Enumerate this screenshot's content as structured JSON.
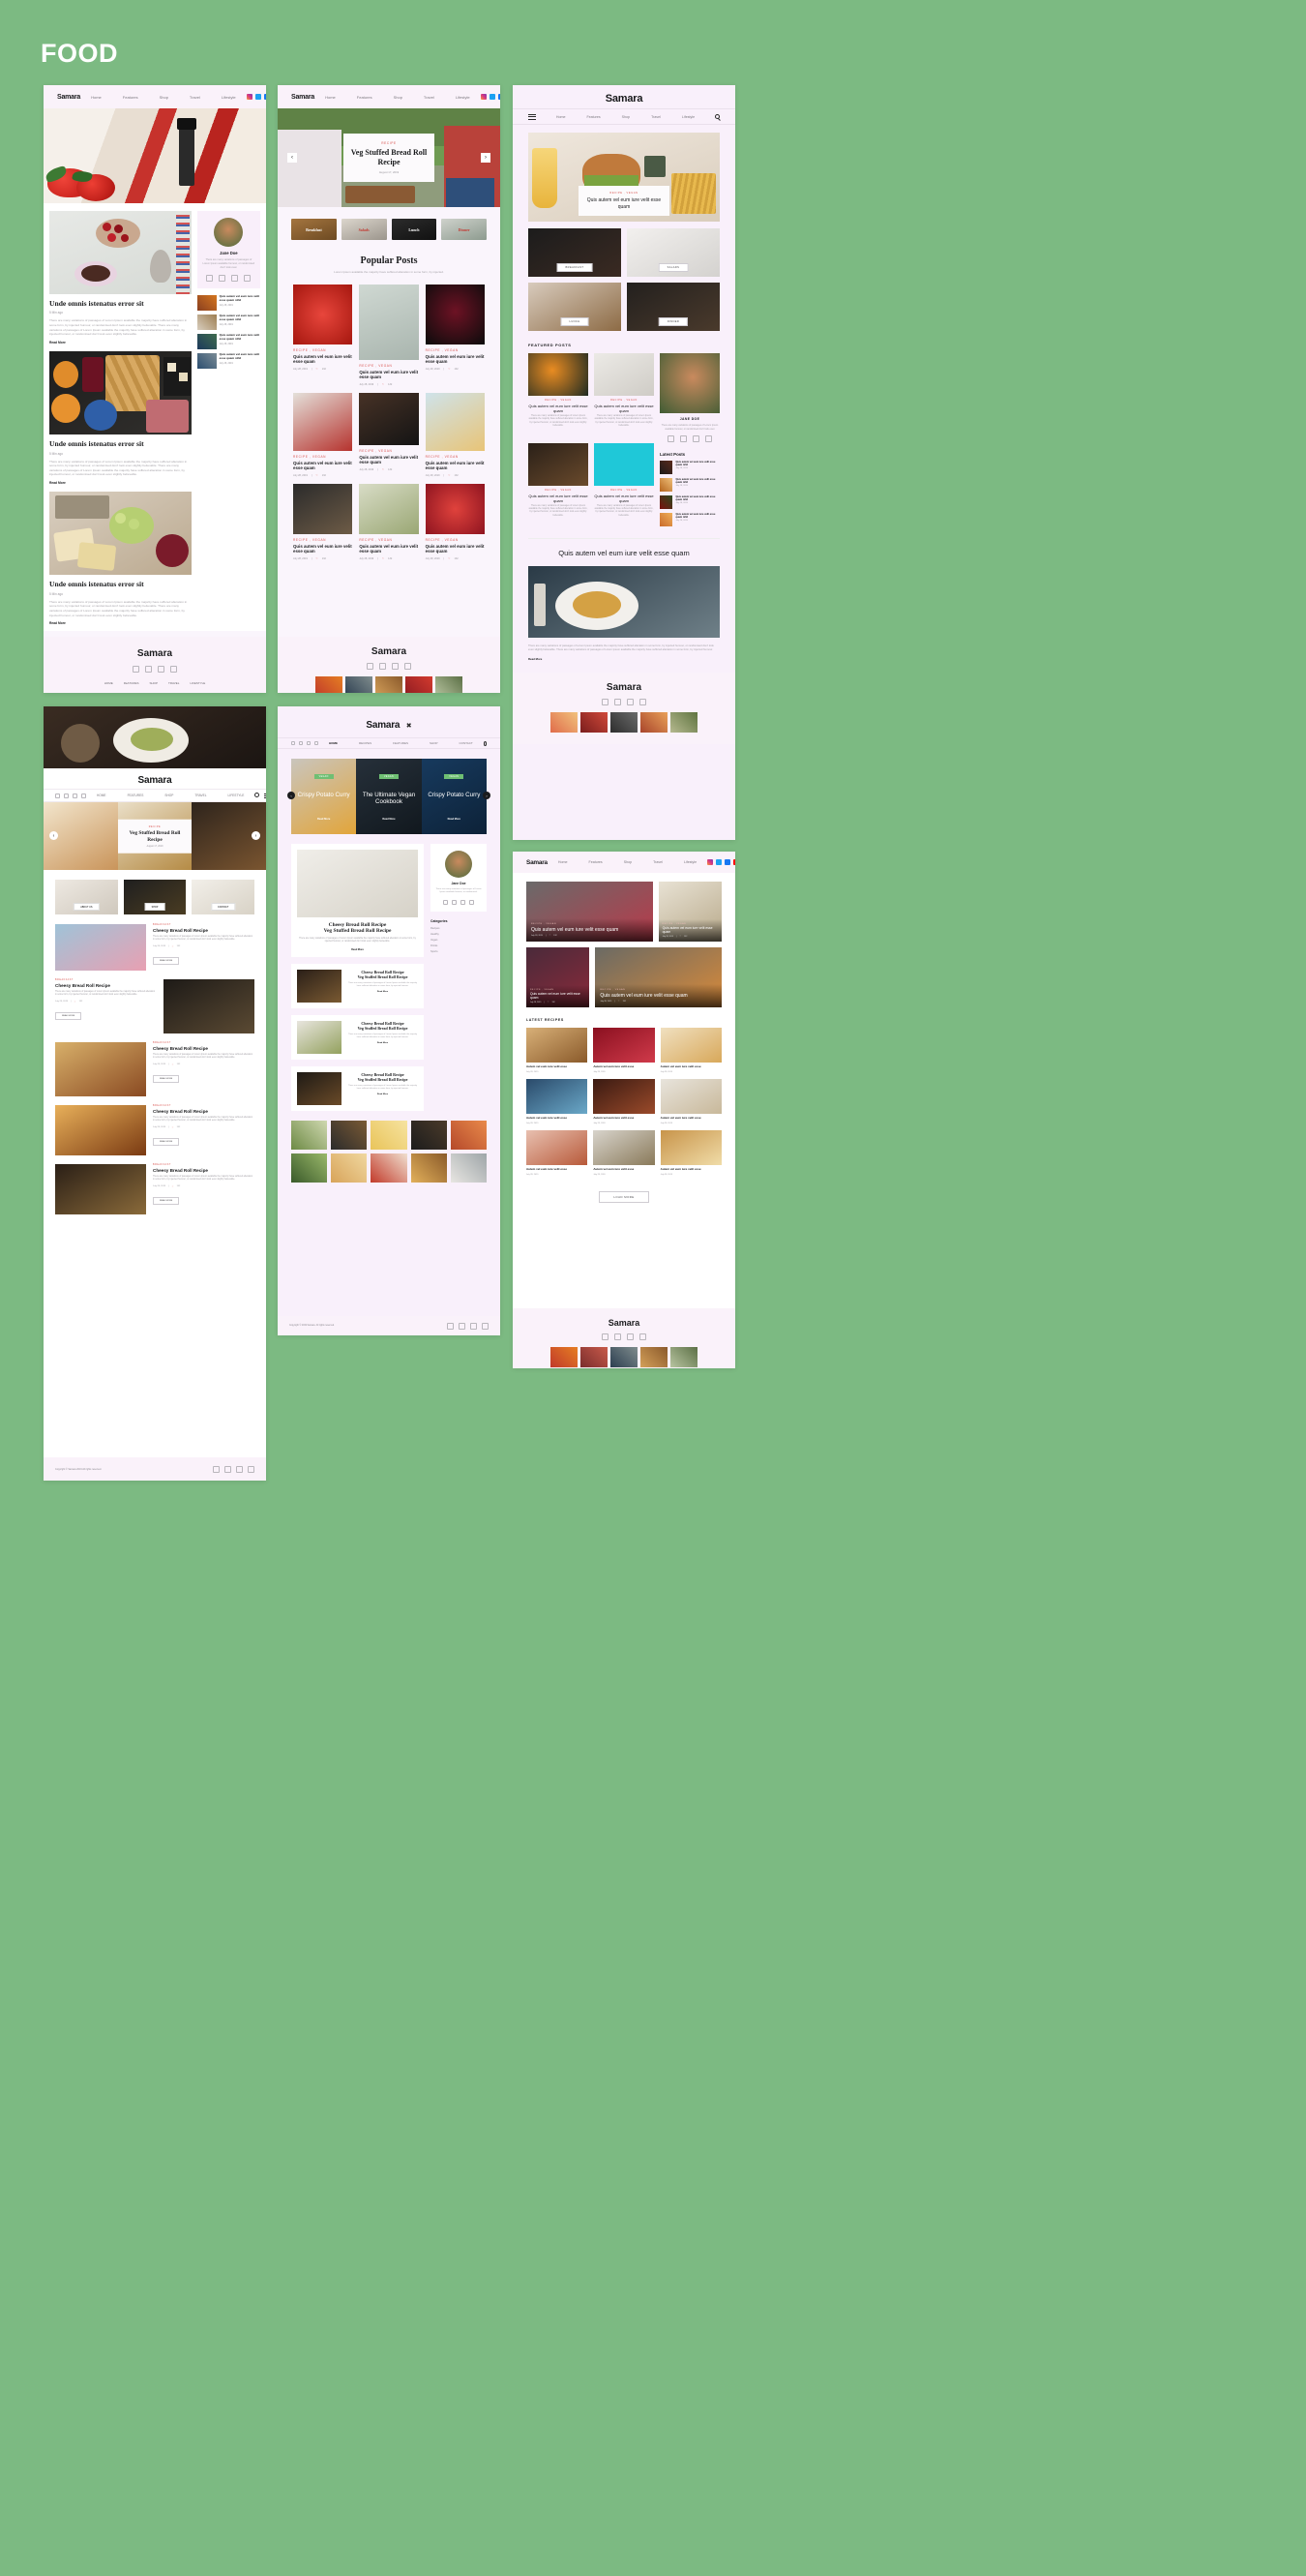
{
  "page": {
    "title": "FOOD",
    "background_color": "#7cba82",
    "card_bg": "#faf5fc"
  },
  "brand": {
    "name": "Samara",
    "name_x": "Samara"
  },
  "nav": {
    "primary": [
      "Home",
      "Features",
      "Shop",
      "Travel",
      "Lifestyle"
    ],
    "uppercase": [
      "HOME",
      "FEATURES",
      "SHOP",
      "TRAVEL",
      "LIFESTYLE"
    ],
    "samarax": [
      "HOME",
      "RECIPES",
      "FEATURES",
      "SHOP",
      "CONTACT"
    ],
    "socials": [
      "instagram-icon",
      "twitter-icon",
      "facebook-icon",
      "youtube-icon"
    ],
    "icons": {
      "menu": "hamburger-icon",
      "search": "search-icon"
    }
  },
  "mock1": {
    "posts": [
      {
        "title": "Unde omnis istenatus error sit",
        "date": "5 Min ago",
        "body": "There are many variations of passages of Lorem Ipsum available the majority have suffered alteration in some form, by injected humour, or randomised don't look even slightly believable. There are many variations of passages of Lorem Ipsum available the majority have suffered alteration in some form, by injected humour, or randomised don't look even slightly believable.",
        "readmore": "Read More"
      },
      {
        "title": "Unde omnis istenatus error sit",
        "date": "5 Min ago",
        "body": "There are many variations of passages of Lorem Ipsum available the majority have suffered alteration in some form, by injected humour, or randomised don't look even slightly believable. There are many variations of passages of Lorem Ipsum available the majority have suffered alteration in some form, by injected humour, or randomised don't look even slightly believable.",
        "readmore": "Read More"
      },
      {
        "title": "Unde omnis istenatus error sit",
        "date": "5 Min ago",
        "body": "There are many variations of passages of Lorem Ipsum available the majority have suffered alteration in some form, by injected humour, or randomised don't look even slightly believable. There are many variations of passages of Lorem Ipsum available the majority have suffered alteration in some form, by injected humour, or randomised don't look even slightly believable.",
        "readmore": "Read More"
      }
    ],
    "author": {
      "name": "Jane Doe",
      "bio": "There are many variations of passages of Lorem Ipsum available humour, or randomised don't look even"
    },
    "sidebar_posts": [
      {
        "title": "Quis autem vel eum iure velit esse quam nihil",
        "date": "July 28, 2019"
      },
      {
        "title": "Quis autem vel eum iure velit esse quam nihil",
        "date": "July 28, 2019"
      },
      {
        "title": "Quis autem vel eum iure velit esse quam nihil",
        "date": "July 28, 2019"
      },
      {
        "title": "Quis autem vel eum iure velit esse quam nihil",
        "date": "July 28, 2019"
      }
    ],
    "footer": {
      "brand": "Samara",
      "links": [
        "HOME",
        "FEATURES",
        "SHOP",
        "TRAVEL",
        "LIFESTYLE"
      ]
    }
  },
  "mock2": {
    "hero": {
      "category": "RECIPE",
      "title": "Veg Stuffed Bread Roll Recipe",
      "date": "August 17, 2019",
      "prev": "‹",
      "next": "›"
    },
    "categories": [
      "Breakfast",
      "Salads",
      "Lunch",
      "Dinner"
    ],
    "section": {
      "heading": "Popular Posts",
      "sub": "Lorem Ipsum available the majority have suffered alteration in some form, by injected."
    },
    "posts": [
      {
        "cat": "RECIPE , VEGAN",
        "title": "Quis autem vel eum iure velit esse quam",
        "date": "July 28, 2019",
        "likes": "132"
      },
      {
        "cat": "RECIPE , VEGAN",
        "title": "Quis autem vel eum iure velit esse quam",
        "date": "July 28, 2019",
        "likes": "132"
      },
      {
        "cat": "RECIPE , VEGAN",
        "title": "Quis autem vel eum iure velit esse quam",
        "date": "July 28, 2019",
        "likes": "132"
      },
      {
        "cat": "RECIPE , VEGAN",
        "title": "Quis autem vel eum iure velit esse quam",
        "date": "July 28, 2019",
        "likes": "132"
      },
      {
        "cat": "RECIPE , VEGAN",
        "title": "Quis autem vel eum iure velit esse quam",
        "date": "July 28, 2019",
        "likes": "132"
      },
      {
        "cat": "RECIPE , VEGAN",
        "title": "Quis autem vel eum iure velit esse quam",
        "date": "July 28, 2019",
        "likes": "132"
      },
      {
        "cat": "RECIPE , VEGAN",
        "title": "Quis autem vel eum iure velit esse quam",
        "date": "July 28, 2019",
        "likes": "132"
      },
      {
        "cat": "RECIPE , VEGAN",
        "title": "Quis autem vel eum iure velit esse quam",
        "date": "July 28, 2019",
        "likes": "132"
      },
      {
        "cat": "RECIPE , VEGAN",
        "title": "Quis autem vel eum iure velit esse quam",
        "date": "July 28, 2019",
        "likes": "132"
      }
    ],
    "footer": {
      "brand": "Samara"
    }
  },
  "mock3": {
    "hero": {
      "category": "RECIPE , VEGAN",
      "title": "Quis autem vel eum iure velit esse quam"
    },
    "tiles": [
      {
        "label": "BREAKFAST"
      },
      {
        "label": "SALADS"
      },
      {
        "label": "LUNCH"
      },
      {
        "label": "DINNER"
      }
    ],
    "featured_heading": "FEATURED POSTS",
    "featured": [
      {
        "cat": "RECIPE , VEGAN",
        "title": "Quis autem vel eum iure velit esse quam",
        "body": "There are many variations of passages of Lorem Ipsum available the majority have suffered alteration in some form, by injected humour, or randomised don't look even slightly believable."
      },
      {
        "cat": "RECIPE , VEGAN",
        "title": "Quis autem vel eum iure velit esse quam",
        "body": "There are many variations of passages of Lorem Ipsum available the majority have suffered alteration in some form, by injected humour, or randomised don't look even slightly believable."
      },
      {
        "cat": "RECIPE , VEGAN",
        "title": "Quis autem vel eum iure velit esse quam",
        "body": "There are many variations of passages of Lorem Ipsum available the majority have suffered alteration in some form, by injected humour, or randomised don't look even slightly believable."
      },
      {
        "cat": "RECIPE , VEGAN",
        "title": "Quis autem vel eum iure velit esse quam",
        "body": "There are many variations of passages of Lorem Ipsum available the majority have suffered alteration in some form, by injected humour, or randomised don't look even slightly believable."
      }
    ],
    "author": {
      "name": "JANE DOE",
      "bio": "There are many variations of passages of Lorem Ipsum available humour, or randomised don't look even"
    },
    "latest_heading": "Latest Posts",
    "latest": [
      {
        "title": "Quis autem vel eum iure velit esse quam nihil",
        "date": "July 28, 2019"
      },
      {
        "title": "Quis autem vel eum iure velit esse quam nihil",
        "date": "July 28, 2019"
      },
      {
        "title": "Quis autem vel eum iure velit esse quam nihil",
        "date": "July 28, 2019"
      },
      {
        "title": "Quis autem vel eum iure velit esse quam nihil",
        "date": "July 28, 2019"
      }
    ],
    "single": {
      "title": "Quis autem vel eum iure velit esse quam",
      "body": "There are many variations of passages of Lorem Ipsum available the majority have suffered alteration in some form, by injected humour, or randomised don't look even slightly believable. There are many variations of passages of Lorem Ipsum available the majority have suffered alteration in some form, by injected humour.",
      "readmore": "Read More"
    },
    "footer": {
      "brand": "Samara"
    }
  },
  "mock4": {
    "slider": {
      "category": "RECIPE",
      "title": "Veg Stuffed Bread Roll Recipe",
      "date": "August 17, 2019"
    },
    "promo": [
      {
        "label": "ABOUT US"
      },
      {
        "label": "SHOP"
      },
      {
        "label": "CONTACT"
      }
    ],
    "posts": [
      {
        "cat": "BREAKFAST",
        "title": "Cheesy Bread Roll Recipe",
        "body": "There are many variations of passages of Lorem Ipsum available the majority have suffered alteration in some form, by injected humour, or randomised don't look even slightly believable.",
        "date": "July 28, 2019",
        "likes": "132",
        "readmore": "READ MORE"
      },
      {
        "cat": "BREAKFAST",
        "title": "Cheesy Bread Roll Recipe",
        "body": "There are many variations of passages of Lorem Ipsum available the majority have suffered alteration in some form, by injected humour, or randomised don't look even slightly believable.",
        "date": "July 28, 2019",
        "likes": "132",
        "readmore": "READ MORE"
      },
      {
        "cat": "BREAKFAST",
        "title": "Cheesy Bread Roll Recipe",
        "body": "There are many variations of passages of Lorem Ipsum available the majority have suffered alteration in some form, by injected humour, or randomised don't look even slightly believable.",
        "date": "July 28, 2019",
        "likes": "132",
        "readmore": "READ MORE"
      },
      {
        "cat": "BREAKFAST",
        "title": "Cheesy Bread Roll Recipe",
        "body": "There are many variations of passages of Lorem Ipsum available the majority have suffered alteration in some form, by injected humour, or randomised don't look even slightly believable.",
        "date": "July 28, 2019",
        "likes": "132",
        "readmore": "READ MORE"
      },
      {
        "cat": "BREAKFAST",
        "title": "Cheesy Bread Roll Recipe",
        "body": "There are many variations of passages of Lorem Ipsum available the majority have suffered alteration in some form, by injected humour, or randomised don't look even slightly believable.",
        "date": "July 28, 2019",
        "likes": "132",
        "readmore": "READ MORE"
      }
    ],
    "footer": {
      "copyright": "Copyright © Samara 2019 All rights reserved."
    }
  },
  "mock5": {
    "slides": [
      {
        "badge": "VEGAN",
        "title": "Crispy Potato Curry",
        "readmore": "Read More"
      },
      {
        "badge": "VEGAN",
        "title": "The Ultimate Vegan Cookbook",
        "readmore": "Read More"
      },
      {
        "badge": "VEGAN",
        "title": "Crispy Potato Curry",
        "readmore": "Read More"
      }
    ],
    "lead": {
      "title1": "Cheesy Bread Roll Recipe",
      "title2": "Veg Stuffed Bread Roll Recipe",
      "body": "There are many variations of passages of Lorem Ipsum available the majority have suffered alteration in some form, by injected humour, or randomised don't look even slightly believable.",
      "readmore": "Read More"
    },
    "author": {
      "name": "Jane Doe",
      "bio": "There are many variations of passages of Lorem Ipsum available humour, or randomised."
    },
    "categories_heading": "Categories",
    "categories": [
      "Recipes",
      "Healthy",
      "Vegan",
      "Drinks",
      "Sports"
    ],
    "list_posts": [
      {
        "title1": "Cheesy Bread Roll Recipe",
        "title2": "Veg Stuffed Bread Roll Recipe",
        "body": "There are many variations of passages of Lorem Ipsum available the majority have suffered alteration in some form, by injected humour.",
        "readmore": "Read More"
      },
      {
        "title1": "Cheesy Bread Roll Recipe",
        "title2": "Veg Stuffed Bread Roll Recipe",
        "body": "There are many variations of passages of Lorem Ipsum available the majority have suffered alteration in some form, by injected humour.",
        "readmore": "Read More"
      },
      {
        "title1": "Cheesy Bread Roll Recipe",
        "title2": "Veg Stuffed Bread Roll Recipe",
        "body": "There are many variations of passages of Lorem Ipsum available the majority have suffered alteration in some form, by injected humour.",
        "readmore": "Read More"
      }
    ],
    "footer": {
      "copyright": "Copyright © 2019 Samara. All rights reserved."
    }
  },
  "mock6": {
    "cards": [
      {
        "cat": "RECIPE , VEGAN",
        "title": "Quis autem vel eum iure velit esse quam",
        "date": "July 28, 2019",
        "likes": "132"
      },
      {
        "cat": "RECIPE , VEGAN",
        "title": "Quis autem vel eum iure velit esse quam",
        "date": "July 28, 2019",
        "likes": "132"
      },
      {
        "cat": "RECIPE , VEGAN",
        "title": "Quis autem vel eum iure velit esse quam",
        "date": "July 28, 2019",
        "likes": "132"
      },
      {
        "cat": "RECIPE , VEGAN",
        "title": "Quis autem vel eum iure velit esse quam",
        "date": "July 28, 2019",
        "likes": "132"
      }
    ],
    "latest_heading": "LATEST RECIPES",
    "latest": [
      {
        "title": "Autem vel eum iure velit esse",
        "date": "July 28, 2019"
      },
      {
        "title": "Autem vel eum iure velit esse",
        "date": "July 28, 2019"
      },
      {
        "title": "Autem vel eum iure velit esse",
        "date": "July 28, 2019"
      },
      {
        "title": "Autem vel eum iure velit esse",
        "date": "July 28, 2019"
      },
      {
        "title": "Autem vel eum iure velit esse",
        "date": "July 28, 2019"
      },
      {
        "title": "Autem vel eum iure velit esse",
        "date": "July 28, 2019"
      },
      {
        "title": "Autem vel eum iure velit esse",
        "date": "July 28, 2019"
      },
      {
        "title": "Autem vel eum iure velit esse",
        "date": "July 28, 2019"
      },
      {
        "title": "Autem vel eum iure velit esse",
        "date": "July 28, 2019"
      }
    ],
    "load_more": "LOAD MORE",
    "footer": {
      "brand": "Samara"
    }
  }
}
